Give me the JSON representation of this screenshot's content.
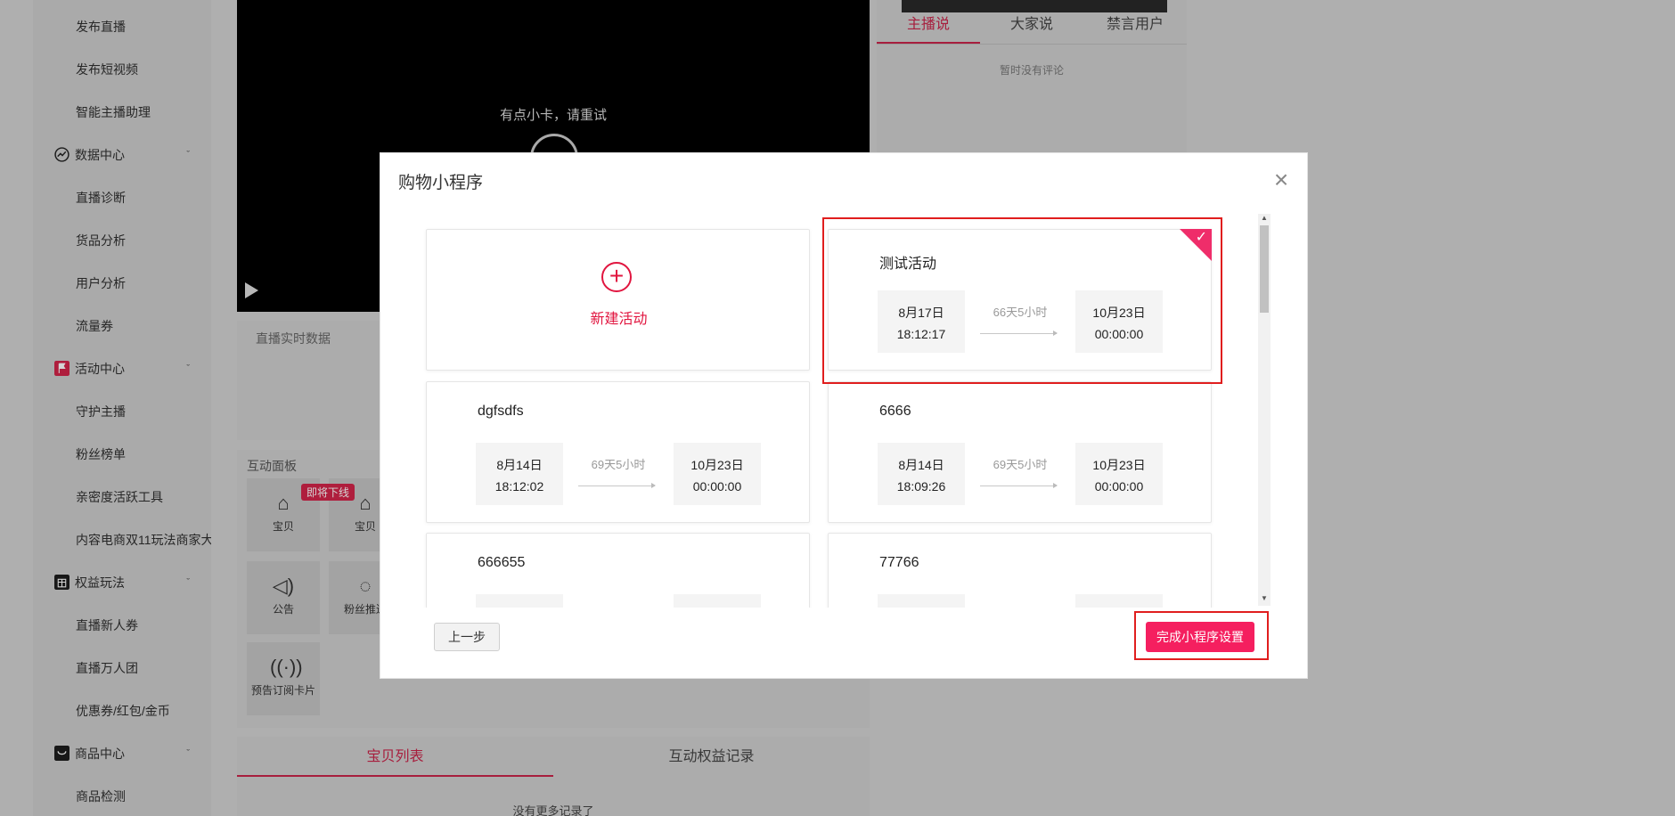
{
  "sidebar": {
    "items": [
      {
        "label": "发布直播",
        "type": "sub"
      },
      {
        "label": "发布短视频",
        "type": "sub"
      },
      {
        "label": "智能主播助理",
        "type": "sub"
      },
      {
        "label": "数据中心",
        "type": "group",
        "icon": "chart-icon"
      },
      {
        "label": "直播诊断",
        "type": "sub"
      },
      {
        "label": "货品分析",
        "type": "sub"
      },
      {
        "label": "用户分析",
        "type": "sub"
      },
      {
        "label": "流量券",
        "type": "sub"
      },
      {
        "label": "活动中心",
        "type": "group",
        "icon": "flag-icon"
      },
      {
        "label": "守护主播",
        "type": "sub"
      },
      {
        "label": "粉丝榜单",
        "type": "sub"
      },
      {
        "label": "亲密度活跃工具",
        "type": "sub"
      },
      {
        "label": "内容电商双11玩法商家大",
        "type": "sub"
      },
      {
        "label": "权益玩法",
        "type": "group",
        "icon": "gift-icon"
      },
      {
        "label": "直播新人券",
        "type": "sub"
      },
      {
        "label": "直播万人团",
        "type": "sub"
      },
      {
        "label": "优惠券/红包/金币",
        "type": "sub"
      },
      {
        "label": "商品中心",
        "type": "group",
        "icon": "bag-icon"
      },
      {
        "label": "商品检测",
        "type": "sub"
      }
    ],
    "chevron": "ˇ"
  },
  "video": {
    "retry_text": "有点小卡，请重试"
  },
  "realtime": {
    "title": "直播实时数据"
  },
  "interact": {
    "title": "互动面板",
    "badge": "即将下线",
    "tiles": [
      {
        "label": "宝贝",
        "icon": "tag-icon"
      },
      {
        "label": "宝贝",
        "icon": "tag-icon"
      },
      {
        "label": "公告",
        "icon": "speaker-icon"
      },
      {
        "label": "粉丝推送",
        "icon": "chat-icon"
      },
      {
        "label": "预告订阅卡片",
        "icon": "broadcast-icon"
      }
    ]
  },
  "bottom_tabs": {
    "tab1": "宝贝列表",
    "tab2": "互动权益记录",
    "empty": "没有更多记录了"
  },
  "right_panel": {
    "tab1": "主播说",
    "tab2": "大家说",
    "tab3": "禁言用户",
    "empty": "暂时没有评论"
  },
  "modal": {
    "title": "购物小程序",
    "close": "×",
    "new_activity": "新建活动",
    "prev_button": "上一步",
    "done_button": "完成小程序设置",
    "activities": [
      {
        "name": "测试活动",
        "start_date": "8月17日",
        "start_time": "18:12:17",
        "duration": "66天5小时",
        "end_date": "10月23日",
        "end_time": "00:00:00",
        "selected": true
      },
      {
        "name": "dgfsdfs",
        "start_date": "8月14日",
        "start_time": "18:12:02",
        "duration": "69天5小时",
        "end_date": "10月23日",
        "end_time": "00:00:00",
        "selected": false
      },
      {
        "name": "6666",
        "start_date": "8月14日",
        "start_time": "18:09:26",
        "duration": "69天5小时",
        "end_date": "10月23日",
        "end_time": "00:00:00",
        "selected": false
      },
      {
        "name": "666655",
        "start_date": "",
        "start_time": "",
        "duration": "",
        "end_date": "",
        "end_time": "",
        "selected": false
      },
      {
        "name": "77766",
        "start_date": "",
        "start_time": "",
        "duration": "",
        "end_date": "",
        "end_time": "",
        "selected": false
      }
    ]
  },
  "colors": {
    "accent": "#e1153f",
    "button": "#f51f5f",
    "highlight": "#e01e1e"
  }
}
